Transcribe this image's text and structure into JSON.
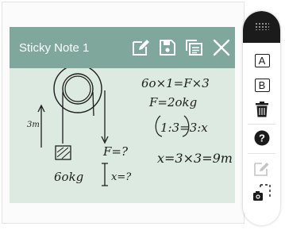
{
  "note": {
    "title": "Sticky Note 1",
    "header_color": "#7fa79c",
    "body_color": "#dceae1",
    "header_icons": [
      "edit-icon",
      "save-icon",
      "copy-icon",
      "close-icon"
    ],
    "handwriting": {
      "left_label": "3m",
      "mass_label": "6okg",
      "force_label": "F=?",
      "distance_label": "x=?",
      "eq1": "6o×1=F×3",
      "eq2": "F=2okg",
      "eq3": "1:3=3:x",
      "eq4": "x=3×3=9m"
    }
  },
  "toolbar": {
    "buttons": [
      {
        "name": "grip",
        "icon": "grip-icon"
      },
      {
        "name": "note-a",
        "label": "A",
        "icon": "letter-a-icon"
      },
      {
        "name": "note-b",
        "label": "B",
        "icon": "letter-b-icon"
      },
      {
        "name": "delete",
        "icon": "trash-icon"
      },
      {
        "name": "help",
        "icon": "help-icon"
      },
      {
        "name": "edit",
        "icon": "edit-icon",
        "disabled": true
      },
      {
        "name": "screenshot",
        "icon": "screenshot-camera-icon"
      }
    ]
  }
}
